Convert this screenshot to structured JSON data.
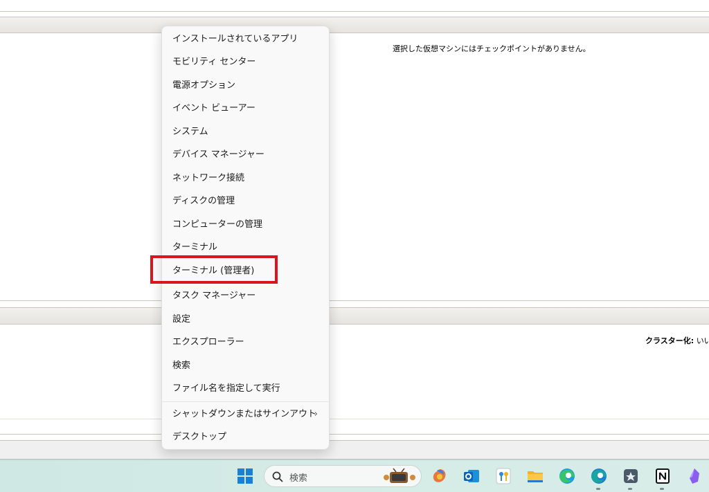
{
  "background": {
    "checkpoint_message": "選択した仮想マシンにはチェックポイントがありません。",
    "cluster_label": "クラスター化:",
    "cluster_value": "いい"
  },
  "menu": {
    "items": [
      {
        "label": "インストールされているアプリ"
      },
      {
        "label": "モビリティ センター"
      },
      {
        "label": "電源オプション"
      },
      {
        "label": "イベント ビューアー"
      },
      {
        "label": "システム"
      },
      {
        "label": "デバイス マネージャー"
      },
      {
        "label": "ネットワーク接続"
      },
      {
        "label": "ディスクの管理"
      },
      {
        "label": "コンピューターの管理"
      },
      {
        "label": "ターミナル"
      },
      {
        "label": "ターミナル (管理者)"
      },
      {
        "label": "タスク マネージャー"
      },
      {
        "label": "設定"
      },
      {
        "label": "エクスプローラー"
      },
      {
        "label": "検索"
      },
      {
        "label": "ファイル名を指定して実行"
      },
      {
        "label": "シャットダウンまたはサインアウト"
      },
      {
        "label": "デスクトップ"
      }
    ],
    "submenu_chevron": "›",
    "highlight_color": "#d9161c"
  },
  "taskbar": {
    "search_placeholder": "検索",
    "icons": [
      "start-icon",
      "search-icon",
      "copilot-icon",
      "outlook-icon",
      "keepass-icon",
      "file-explorer-icon",
      "edge-icon",
      "edge-beta-icon",
      "app-icon",
      "notion-icon",
      "obsidian-icon"
    ]
  }
}
